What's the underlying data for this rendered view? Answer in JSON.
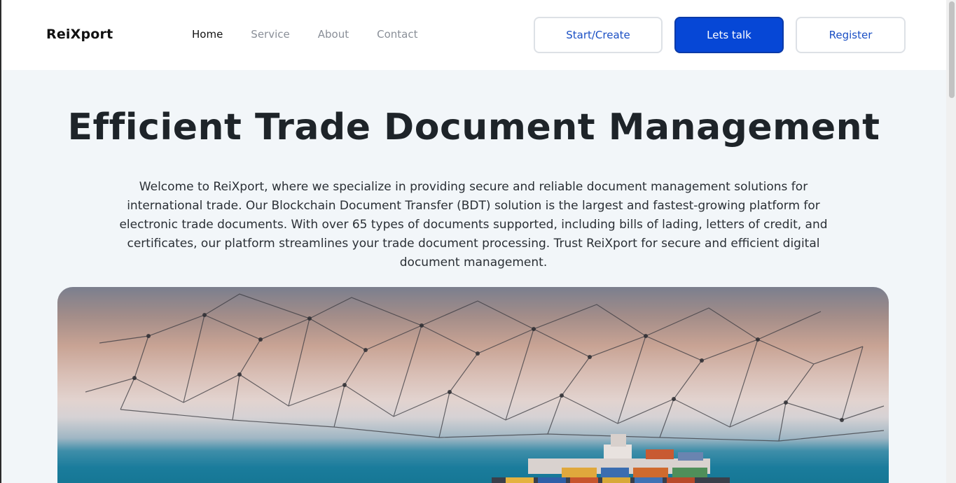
{
  "header": {
    "logo": "ReiXport",
    "nav": [
      "Home",
      "Service",
      "About",
      "Contact"
    ],
    "active_nav": "Home",
    "buttons": {
      "start_create": "Start/Create",
      "lets_talk": "Lets talk",
      "register": "Register"
    }
  },
  "hero": {
    "title": "Efficient Trade Document Management",
    "description": "Welcome to ReiXport, where we specialize in providing secure and reliable document management solutions for international trade. Our Blockchain Document Transfer (BDT) solution is the largest and fastest-growing platform for electronic trade documents. With over 65 types of documents supported, including bills of lading, letters of credit, and certificates, our platform streamlines your trade document processing. Trust ReiXport for secure and efficient digital document management.",
    "image": "cargo-ship-network-illustration"
  },
  "colors": {
    "primary": "#0647d6",
    "outline_text": "#1a4fc4",
    "background": "#f2f6f9",
    "nav_inactive": "#8a8f98"
  }
}
